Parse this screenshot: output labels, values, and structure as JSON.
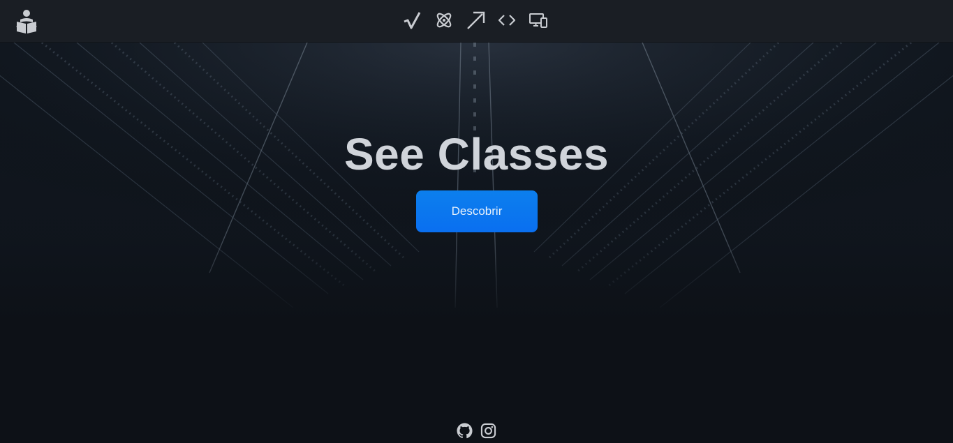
{
  "hero": {
    "title": "See Classes",
    "button_label": "Descobrir"
  },
  "nav": {
    "icons": [
      "sqrt-icon",
      "atom-icon",
      "arrow-up-right-icon",
      "code-icon",
      "devices-icon"
    ]
  },
  "footer": {
    "icons": [
      "github-icon",
      "instagram-icon"
    ]
  },
  "colors": {
    "background": "#0d1117",
    "navbar": "#1a1e24",
    "accent": "#0a73ee",
    "title": "#d0d4da",
    "icon": "#c9ccd1"
  }
}
